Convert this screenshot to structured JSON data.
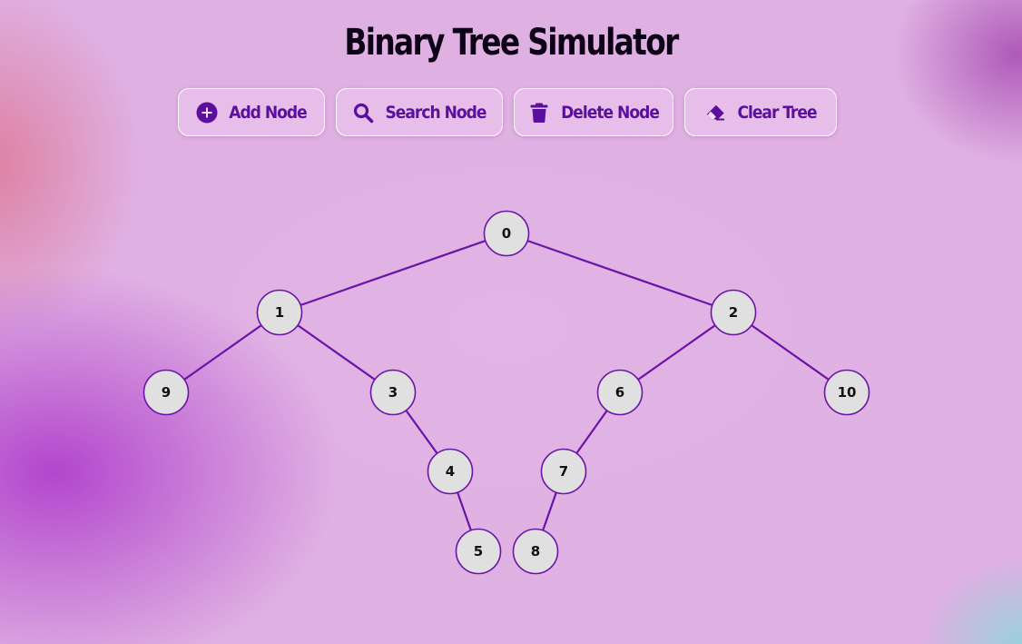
{
  "title": "Binary Tree Simulator",
  "toolbar": {
    "add_label": "Add Node",
    "search_label": "Search Node",
    "delete_label": "Delete Node",
    "clear_label": "Clear Tree",
    "add_icon": "plus-circle-icon",
    "search_icon": "magnifier-icon",
    "delete_icon": "trash-icon",
    "clear_icon": "eraser-icon"
  },
  "colors": {
    "accent": "#5a0f9e",
    "edge": "#6a14a8",
    "node_fill": "#e0e0e0",
    "node_stroke": "#6a14a8"
  },
  "tree": {
    "nodes": [
      {
        "id": "0",
        "label": "0"
      },
      {
        "id": "1",
        "label": "1"
      },
      {
        "id": "2",
        "label": "2"
      },
      {
        "id": "9",
        "label": "9"
      },
      {
        "id": "3",
        "label": "3"
      },
      {
        "id": "6",
        "label": "6"
      },
      {
        "id": "10",
        "label": "10"
      },
      {
        "id": "4",
        "label": "4"
      },
      {
        "id": "7",
        "label": "7"
      },
      {
        "id": "5",
        "label": "5"
      },
      {
        "id": "8",
        "label": "8"
      }
    ],
    "edges": [
      [
        "0",
        "1"
      ],
      [
        "0",
        "2"
      ],
      [
        "1",
        "9"
      ],
      [
        "1",
        "3"
      ],
      [
        "3",
        "4"
      ],
      [
        "4",
        "5"
      ],
      [
        "2",
        "6"
      ],
      [
        "2",
        "10"
      ],
      [
        "6",
        "7"
      ],
      [
        "7",
        "8"
      ]
    ]
  }
}
